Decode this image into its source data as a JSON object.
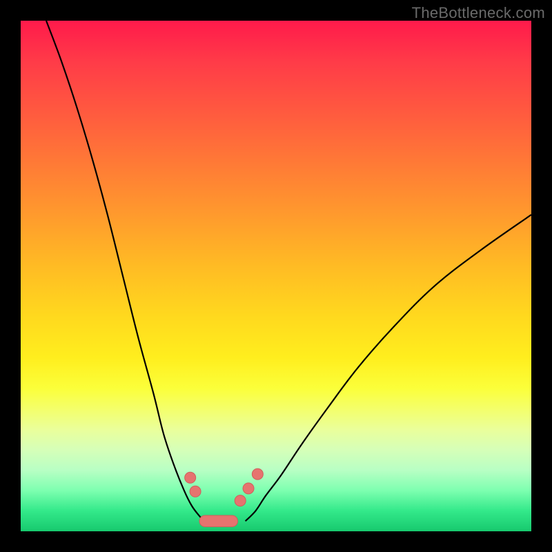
{
  "watermark": "TheBottleneck.com",
  "chart_data": {
    "type": "line",
    "title": "",
    "xlabel": "",
    "ylabel": "",
    "xlim": [
      0,
      100
    ],
    "ylim": [
      0,
      100
    ],
    "series": [
      {
        "name": "left-curve",
        "x": [
          5,
          8,
          11,
          14,
          17,
          20,
          23,
          26,
          28,
          30,
          32,
          33.5,
          35,
          36
        ],
        "y": [
          100,
          92,
          83,
          73,
          62,
          50,
          38,
          27,
          19,
          13,
          8,
          5,
          3,
          2
        ]
      },
      {
        "name": "right-curve",
        "x": [
          44,
          46,
          48,
          51,
          55,
          60,
          66,
          73,
          81,
          90,
          100
        ],
        "y": [
          2,
          4,
          7,
          11,
          17,
          24,
          32,
          40,
          48,
          55,
          62
        ]
      }
    ],
    "markers": {
      "dots_left": [
        {
          "x": 33.2,
          "y": 10.5
        },
        {
          "x": 34.2,
          "y": 7.8
        }
      ],
      "dots_right": [
        {
          "x": 43.0,
          "y": 6.0
        },
        {
          "x": 44.6,
          "y": 8.4
        },
        {
          "x": 46.4,
          "y": 11.2
        }
      ],
      "floor_bar": {
        "x0": 35.0,
        "x1": 42.5,
        "y": 2.0,
        "height": 2.2
      }
    },
    "gradient_note": "background vertical gradient red→orange→yellow→green representing bottleneck severity"
  }
}
